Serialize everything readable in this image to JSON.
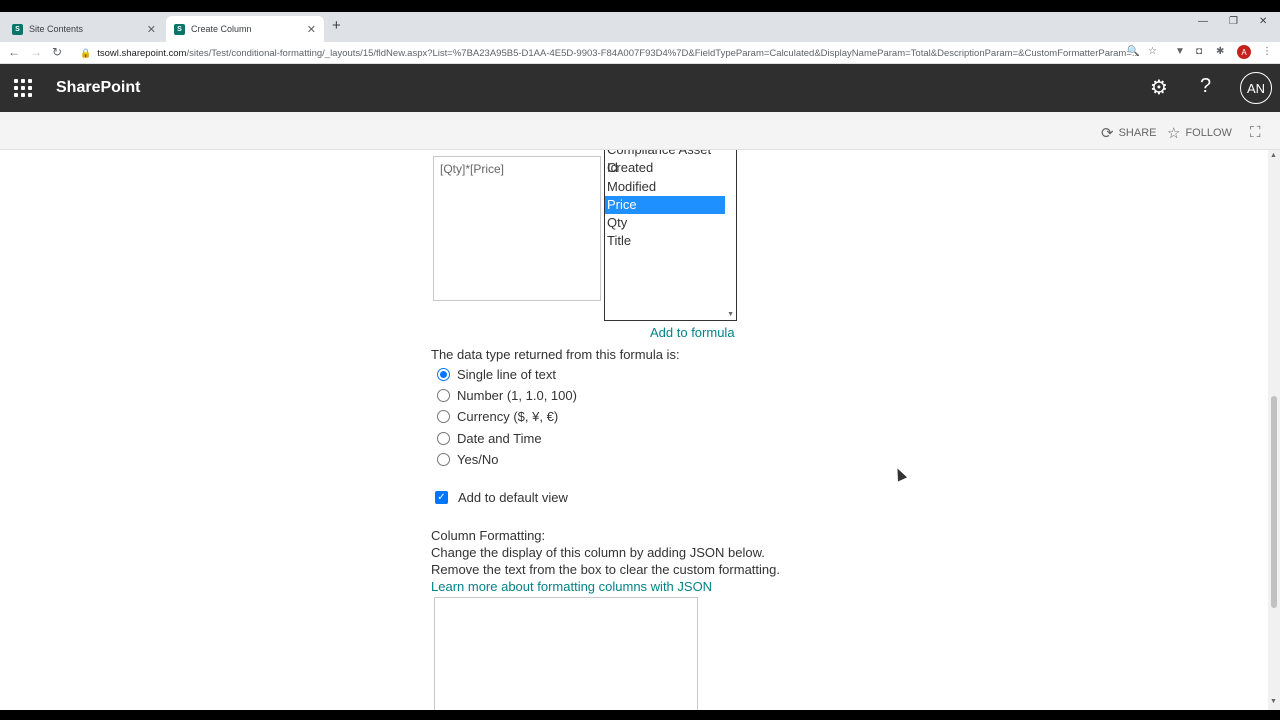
{
  "browser": {
    "tabs": [
      {
        "label": "Site Contents",
        "active": false
      },
      {
        "label": "Create Column",
        "active": true
      }
    ],
    "new_tab_glyph": "+",
    "close_glyph": "✕",
    "window_controls": [
      "—",
      "❐",
      "✕"
    ],
    "url_host": "tsowl.sharepoint.com",
    "url_path": "/sites/Test/conditional-formatting/_layouts/15/fldNew.aspx?List=%7BA23A95B5-D1AA-4E5D-9903-F84A007F93D4%7D&FieldTypeParam=Calculated&DisplayNameParam=Total&DescriptionParam=&CustomFormatterParam=...",
    "profile_initial": "A"
  },
  "suitebar": {
    "brand": "SharePoint",
    "avatar_initials": "AN"
  },
  "commandbar": {
    "share_label": "SHARE",
    "follow_label": "FOLLOW"
  },
  "form": {
    "formula_value": "[Qty]*[Price]",
    "field_list": [
      "Compliance Asset Id",
      "Created",
      "Modified",
      "Price",
      "Qty",
      "Title"
    ],
    "selected_field": "Price",
    "add_to_formula": "Add to formula",
    "data_type_label": "The data type returned from this formula is:",
    "data_types": [
      {
        "label": "Single line of text",
        "checked": true
      },
      {
        "label": "Number (1, 1.0, 100)",
        "checked": false
      },
      {
        "label": "Currency ($, ¥, €)",
        "checked": false
      },
      {
        "label": "Date and Time",
        "checked": false
      },
      {
        "label": "Yes/No",
        "checked": false
      }
    ],
    "add_default_view": "Add to default view",
    "add_default_view_checked": true,
    "column_formatting_title": "Column Formatting:",
    "column_formatting_desc1": "Change the display of this column by adding JSON below.",
    "column_formatting_desc2": "Remove the text from the box to clear the custom formatting.",
    "learn_more_link": "Learn more about formatting columns with JSON",
    "json_value": ""
  }
}
